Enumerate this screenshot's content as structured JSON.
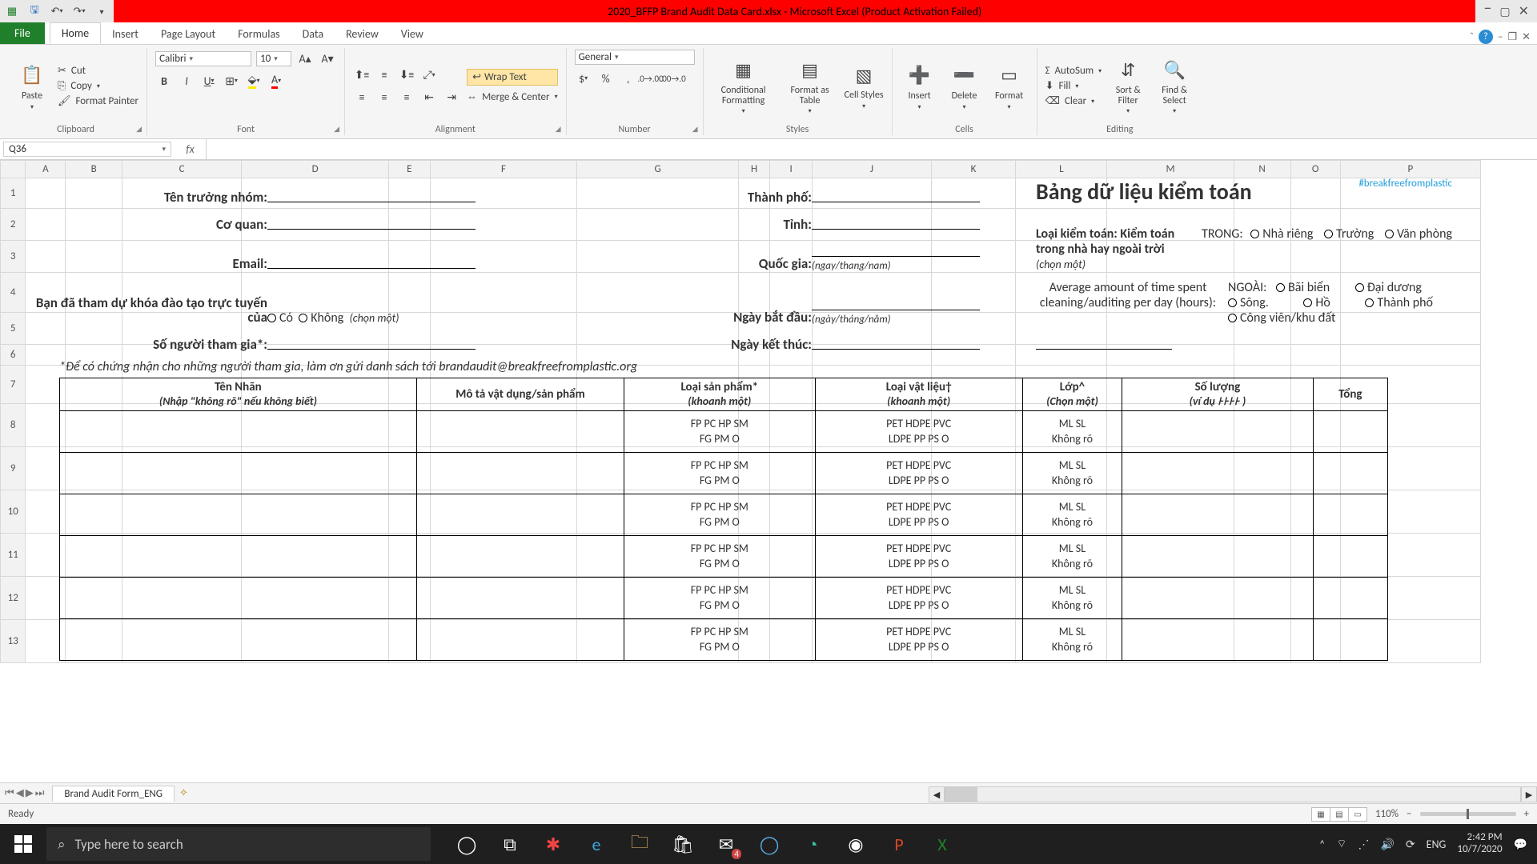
{
  "title": "2020_BFFP Brand Audit Data Card.xlsx  -  Microsoft Excel (Product Activation Failed)",
  "tabs": {
    "file": "File",
    "home": "Home",
    "insert": "Insert",
    "layout": "Page Layout",
    "formulas": "Formulas",
    "data": "Data",
    "review": "Review",
    "view": "View"
  },
  "ribbon": {
    "paste": "Paste",
    "cut": "Cut",
    "copy": "Copy",
    "fmtpainter": "Format Painter",
    "clipboard": "Clipboard",
    "fontname": "Calibri",
    "fontsize": "10",
    "fontgrp": "Font",
    "wrap": "Wrap Text",
    "merge": "Merge & Center",
    "aligngrp": "Alignment",
    "numfmt": "General",
    "numgrp": "Number",
    "cond": "Conditional Formatting",
    "fmttable": "Format as Table",
    "cellstyles": "Cell Styles",
    "stylesgrp": "Styles",
    "insert": "Insert",
    "delete": "Delete",
    "format": "Format",
    "cellsgrp": "Cells",
    "autosum": "AutoSum",
    "fill": "Fill",
    "clear": "Clear",
    "sort": "Sort & Filter",
    "find": "Find & Select",
    "editgrp": "Editing"
  },
  "namebox": "Q36",
  "cols": [
    "A",
    "B",
    "C",
    "D",
    "E",
    "F",
    "G",
    "H",
    "I",
    "J",
    "K",
    "L",
    "M",
    "N",
    "O",
    "P"
  ],
  "rowcount": 13,
  "form": {
    "team": "Tên trưởng nhóm:",
    "org": "Cơ quan:",
    "email": "Email:",
    "training": "Bạn đã tham dự khóa đào tạo trực tuyến của",
    "yes": "Có",
    "no": "Không",
    "chooseone": "(chọn một)",
    "participants": "Số người tham gia*:",
    "city": "Thành phố:",
    "province": "Tỉnh:",
    "country": "Quốc gia:",
    "datefmt1": "(ngay/thang/nam)",
    "datefmt2": "(ngày/tháng/năm)",
    "start": "Ngày bắt đầu:",
    "end": "Ngày kết thúc:",
    "title": "Bảng dữ liệu kiểm toán",
    "audittype": "Loại kiểm toán: Kiểm toán trong nhà hay ngoài trời",
    "avgtime": "Average amount of time spent cleaning/auditing per day (hours):",
    "indoor": "TRONG:",
    "opt_home": "Nhà riêng",
    "opt_school": "Trường",
    "opt_office": "Văn phòng",
    "outdoor": "NGOÀI:",
    "opt_beach": "Bãi biển",
    "opt_ocean": "Đại dương",
    "opt_river": "Sông.",
    "opt_lake": "Hồ",
    "opt_city": "Thành phố",
    "opt_park": "Công viên/khu đất",
    "hashtag": "#breakfreefromplastic",
    "cert": "*Để có chứng nhận cho những người tham gia, làm ơn gửi danh sách tới brandaudit@breakfreefromplastic.org"
  },
  "tablehdr": {
    "brand": "Tên Nhãn",
    "brand_sub": "(Nhập \"không rõ\" nếu không biết)",
    "desc": "Mô tả vật dụng/sản phẩm",
    "prodtype": "Loại sản phẩm*",
    "prodtype_sub": "(khoanh một)",
    "material": "Loại vật liệu†",
    "material_sub": "(khoanh một)",
    "layer": "Lớp^",
    "layer_sub": "(Chọn một)",
    "qty": "Số lượng",
    "qty_sub": "(ví dụ ꜔꜔꜔꜔ )",
    "total": "Tổng"
  },
  "celltext": {
    "prod_row1": "FP    PC    HP   SM",
    "prod_row2": "FG    PM   O",
    "mat_row1": "PET    HDPE    PVC",
    "mat_row2": "LDPE    PP    PS    O",
    "lay_row1": "ML    SL",
    "lay_row2": "Không rõ"
  },
  "sheettab": "Brand Audit Form_ENG",
  "status": "Ready",
  "zoom": "110%",
  "taskbar": {
    "search": "Type here to search",
    "lang": "ENG",
    "time": "2:42 PM",
    "date": "10/7/2020",
    "mailcount": "4"
  }
}
